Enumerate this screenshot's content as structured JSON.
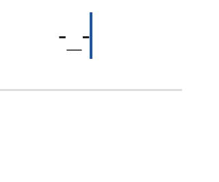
{
  "search": {
    "query": "-_-",
    "logo_icon": "google-g-icon",
    "caret_color": "#1a56b0"
  },
  "colors": {
    "background": "#ffffff",
    "text": "#202124",
    "divider": "#dedede",
    "logo_blue": "#4285f4",
    "logo_red": "#ea4335"
  }
}
